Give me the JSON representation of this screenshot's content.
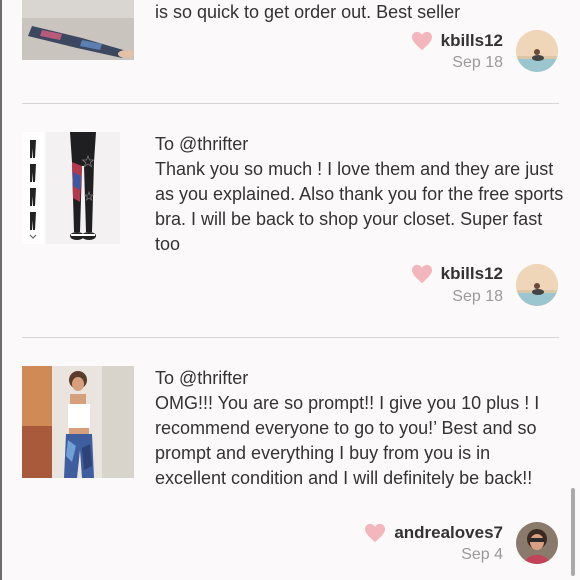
{
  "reviews": [
    {
      "to": "",
      "text": "is so quick to get order out. Best seller",
      "username": "kbills12",
      "date": "Sep 18"
    },
    {
      "to": "To @thrifter",
      "text": "Thank you so much ! I love them and they are just as you explained. Also thank you for the free sports bra. I will be back to shop your closet. Super fast too",
      "username": "kbills12",
      "date": "Sep 18"
    },
    {
      "to": "To @thrifter",
      "text": "OMG!!! You are so prompt!! I give you 10 plus ! I recommend everyone to go to you!’ Best and so prompt and everything I buy from you is in excellent condition and I will definitely be back!!",
      "username": "andrealoves7",
      "date": "Sep 4"
    }
  ],
  "colors": {
    "heart": "#f4b6bd",
    "background": "#fbf9fa",
    "divider": "#d8d6d7"
  },
  "icons": [
    "heart-icon",
    "chevron-down-icon"
  ]
}
